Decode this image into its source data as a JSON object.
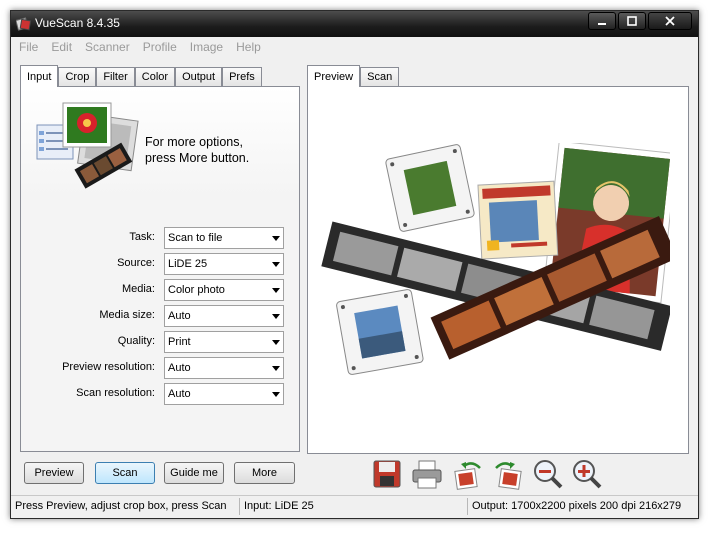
{
  "window": {
    "title": "VueScan 8.4.35"
  },
  "titlebar_buttons": [
    "minimize",
    "maximize",
    "close"
  ],
  "menu": [
    "File",
    "Edit",
    "Scanner",
    "Profile",
    "Image",
    "Help"
  ],
  "left_tabs": [
    "Input",
    "Crop",
    "Filter",
    "Color",
    "Output",
    "Prefs"
  ],
  "left_active_tab": "Input",
  "banner": {
    "line1": "For more options,",
    "line2": "press More button."
  },
  "fields": [
    {
      "label": "Task:",
      "value": "Scan to file"
    },
    {
      "label": "Source:",
      "value": "LiDE 25"
    },
    {
      "label": "Media:",
      "value": "Color photo"
    },
    {
      "label": "Media size:",
      "value": "Auto"
    },
    {
      "label": "Quality:",
      "value": "Print"
    },
    {
      "label": "Preview resolution:",
      "value": "Auto"
    },
    {
      "label": "Scan resolution:",
      "value": "Auto"
    }
  ],
  "right_tabs": [
    "Preview",
    "Scan"
  ],
  "right_active_tab": "Preview",
  "buttons": {
    "preview": "Preview",
    "scan": "Scan",
    "guide": "Guide me",
    "more": "More"
  },
  "toolbar_icons": [
    "save-icon",
    "print-icon",
    "rotate-left-icon",
    "rotate-right-icon",
    "zoom-out-icon",
    "zoom-in-icon"
  ],
  "status": {
    "left": "Press Preview, adjust crop box, press Scan",
    "middle": "Input: LiDE 25",
    "right": "Output: 1700x2200 pixels 200 dpi 216x279"
  },
  "colors": {
    "titlebar": "#1c1c1c",
    "focus": "#3c7fb1",
    "disabled_menu": "#9a9a9a"
  }
}
